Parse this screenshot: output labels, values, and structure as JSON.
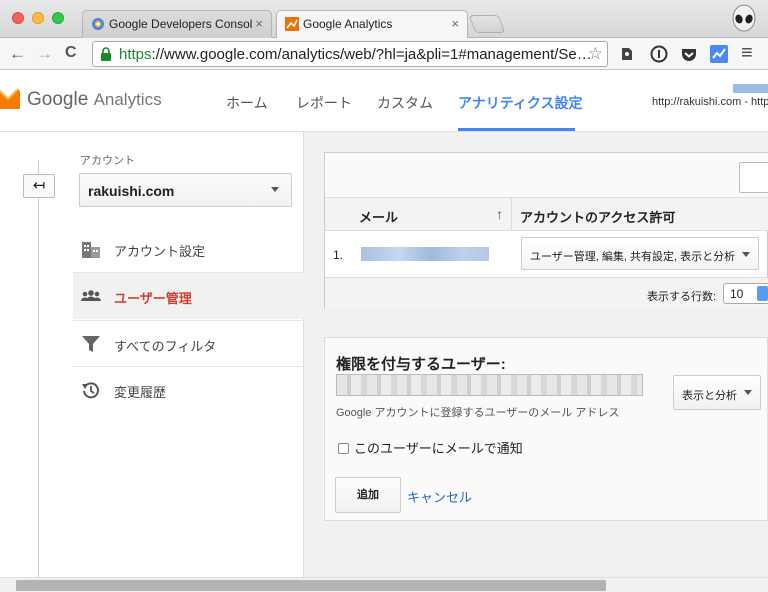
{
  "browser": {
    "tabs": [
      {
        "title": "Google Developers Consol",
        "close": "×"
      },
      {
        "title": "Google Analytics",
        "close": "×"
      }
    ],
    "url": {
      "https": "https",
      "rest": "://www.google.com/analytics/web/?hl=ja&pli=1#management/Se…"
    },
    "nav": {
      "back": "←",
      "forward": "→",
      "reload": "C"
    },
    "star": "☆",
    "menu": "≡"
  },
  "header": {
    "logo_google": "Google",
    "logo_product": "Analytics",
    "nav": [
      {
        "label": "ホーム"
      },
      {
        "label": "レポート"
      },
      {
        "label": "カスタム"
      },
      {
        "label": "アナリティクス設定"
      }
    ],
    "account_url": "http://rakuishi.com - http"
  },
  "sidebar": {
    "back": "↤",
    "account_label": "アカウント",
    "account_value": "rakuishi.com",
    "items": [
      {
        "label": "アカウント設定",
        "icon": "building-icon"
      },
      {
        "label": "ユーザー管理",
        "icon": "users-icon"
      },
      {
        "label": "すべてのフィルタ",
        "icon": "filter-icon"
      },
      {
        "label": "変更履歴",
        "icon": "history-icon"
      }
    ]
  },
  "users_table": {
    "columns": [
      "メール",
      "アカウントのアクセス許可"
    ],
    "sort": "↑",
    "rows": [
      {
        "num": "1.",
        "permission": "ユーザー管理, 編集, 共有設定, 表示と分析"
      }
    ],
    "rows_label": "表示する行数:",
    "rows_value": "10"
  },
  "grant": {
    "title": "権限を付与するユーザー:",
    "hint": "Google アカウントに登録するユーザーのメール アドレス",
    "permission": "表示と分析",
    "notify": "このユーザーにメールで通知",
    "add": "追加",
    "cancel": "キャンセル"
  },
  "colors": {
    "accent": "#4285f4",
    "active_item": "#d23f31",
    "link": "#2563c9"
  }
}
